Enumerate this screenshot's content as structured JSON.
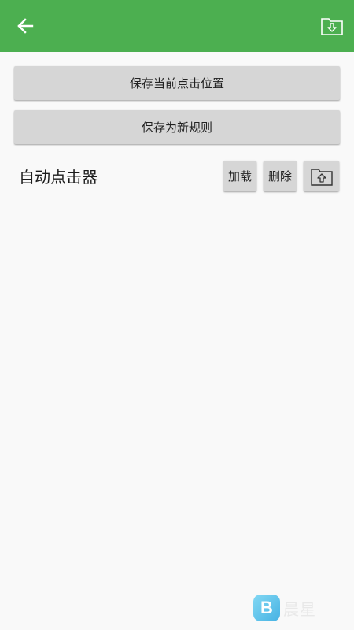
{
  "colors": {
    "appbar": "#4caf50",
    "background": "#f9f9f9",
    "button": "#d6d6d6"
  },
  "appbar": {
    "back_icon": "arrow-left-icon",
    "import_icon": "folder-download-icon"
  },
  "buttons": {
    "save_position": "保存当前点击位置",
    "save_rule": "保存为新规则"
  },
  "rule": {
    "name": "自动点击器",
    "load_label": "加载",
    "delete_label": "删除",
    "export_icon": "folder-upload-icon"
  },
  "watermark": {
    "logo_letter": "B",
    "text": "晨星"
  }
}
